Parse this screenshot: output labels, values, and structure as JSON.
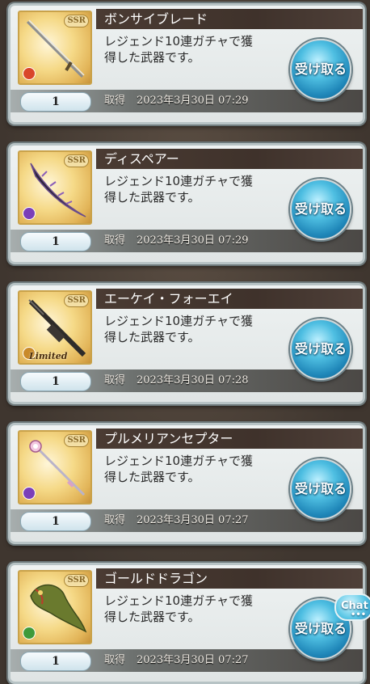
{
  "items": [
    {
      "name": "ボンサイブレード",
      "desc_line1": "レジェンド10連ガチャで獲",
      "desc_line2": "得した武器です。",
      "quantity": "1",
      "acquired_label": "取得",
      "acquired_date": "2023年3月30日 07:29",
      "receive_label": "受け取る",
      "rarity": "SSR",
      "element_color": "#d9452a",
      "weapon_icon": "thin-sword-icon",
      "limited": ""
    },
    {
      "name": "ディスペアー",
      "desc_line1": "レジェンド10連ガチャで獲",
      "desc_line2": "得した武器です。",
      "quantity": "1",
      "acquired_label": "取得",
      "acquired_date": "2023年3月30日 07:29",
      "receive_label": "受け取る",
      "rarity": "SSR",
      "element_color": "#7b3fb8",
      "weapon_icon": "dark-blade-icon",
      "limited": ""
    },
    {
      "name": "エーケイ・フォーエイ",
      "desc_line1": "レジェンド10連ガチャで獲",
      "desc_line2": "得した武器です。",
      "quantity": "1",
      "acquired_label": "取得",
      "acquired_date": "2023年3月30日 07:28",
      "receive_label": "受け取る",
      "rarity": "SSR",
      "element_color": "#c98a2a",
      "weapon_icon": "rifle-icon",
      "limited": "Limited"
    },
    {
      "name": "プルメリアンセプター",
      "desc_line1": "レジェンド10連ガチャで獲",
      "desc_line2": "得した武器です。",
      "quantity": "1",
      "acquired_label": "取得",
      "acquired_date": "2023年3月30日 07:27",
      "receive_label": "受け取る",
      "rarity": "SSR",
      "element_color": "#7b3fb8",
      "weapon_icon": "scepter-icon",
      "limited": ""
    },
    {
      "name": "ゴールドドラゴン",
      "desc_line1": "レジェンド10連ガチャで獲",
      "desc_line2": "得した武器です。",
      "quantity": "1",
      "acquired_label": "取得",
      "acquired_date": "2023年3月30日 07:27",
      "receive_label": "受け取る",
      "rarity": "SSR",
      "element_color": "#3f9a3a",
      "weapon_icon": "golden-dragon-icon",
      "limited": ""
    }
  ],
  "chat_label": "Chat"
}
